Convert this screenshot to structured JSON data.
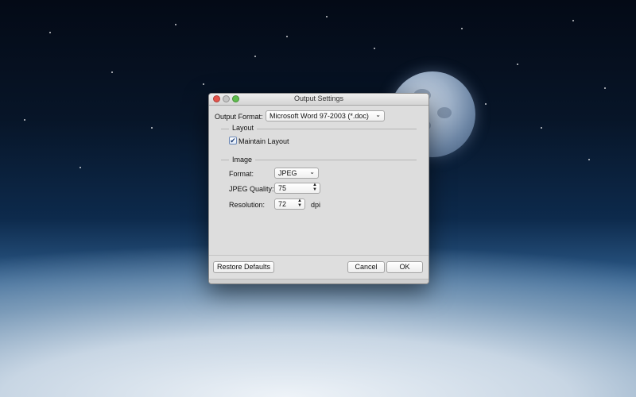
{
  "window": {
    "title": "Output Settings"
  },
  "output_format": {
    "label": "Output Format:",
    "selected": "Microsoft Word 97-2003 (*.doc)"
  },
  "layout": {
    "section_label": "Layout",
    "maintain_layout_label": "Maintain Layout",
    "maintain_layout_checked": true,
    "check_glyph": "✔"
  },
  "image": {
    "section_label": "Image",
    "format_label": "Format:",
    "format_selected": "JPEG",
    "quality_label": "JPEG Quality:",
    "quality_value": "75",
    "resolution_label": "Resolution:",
    "resolution_value": "72",
    "resolution_unit": "dpi"
  },
  "buttons": {
    "restore_defaults": "Restore Defaults",
    "cancel": "Cancel",
    "ok": "OK"
  },
  "colors": {
    "close": "#e4534b",
    "minimize": "#c4c4c4",
    "maximize": "#5fbd4d"
  }
}
